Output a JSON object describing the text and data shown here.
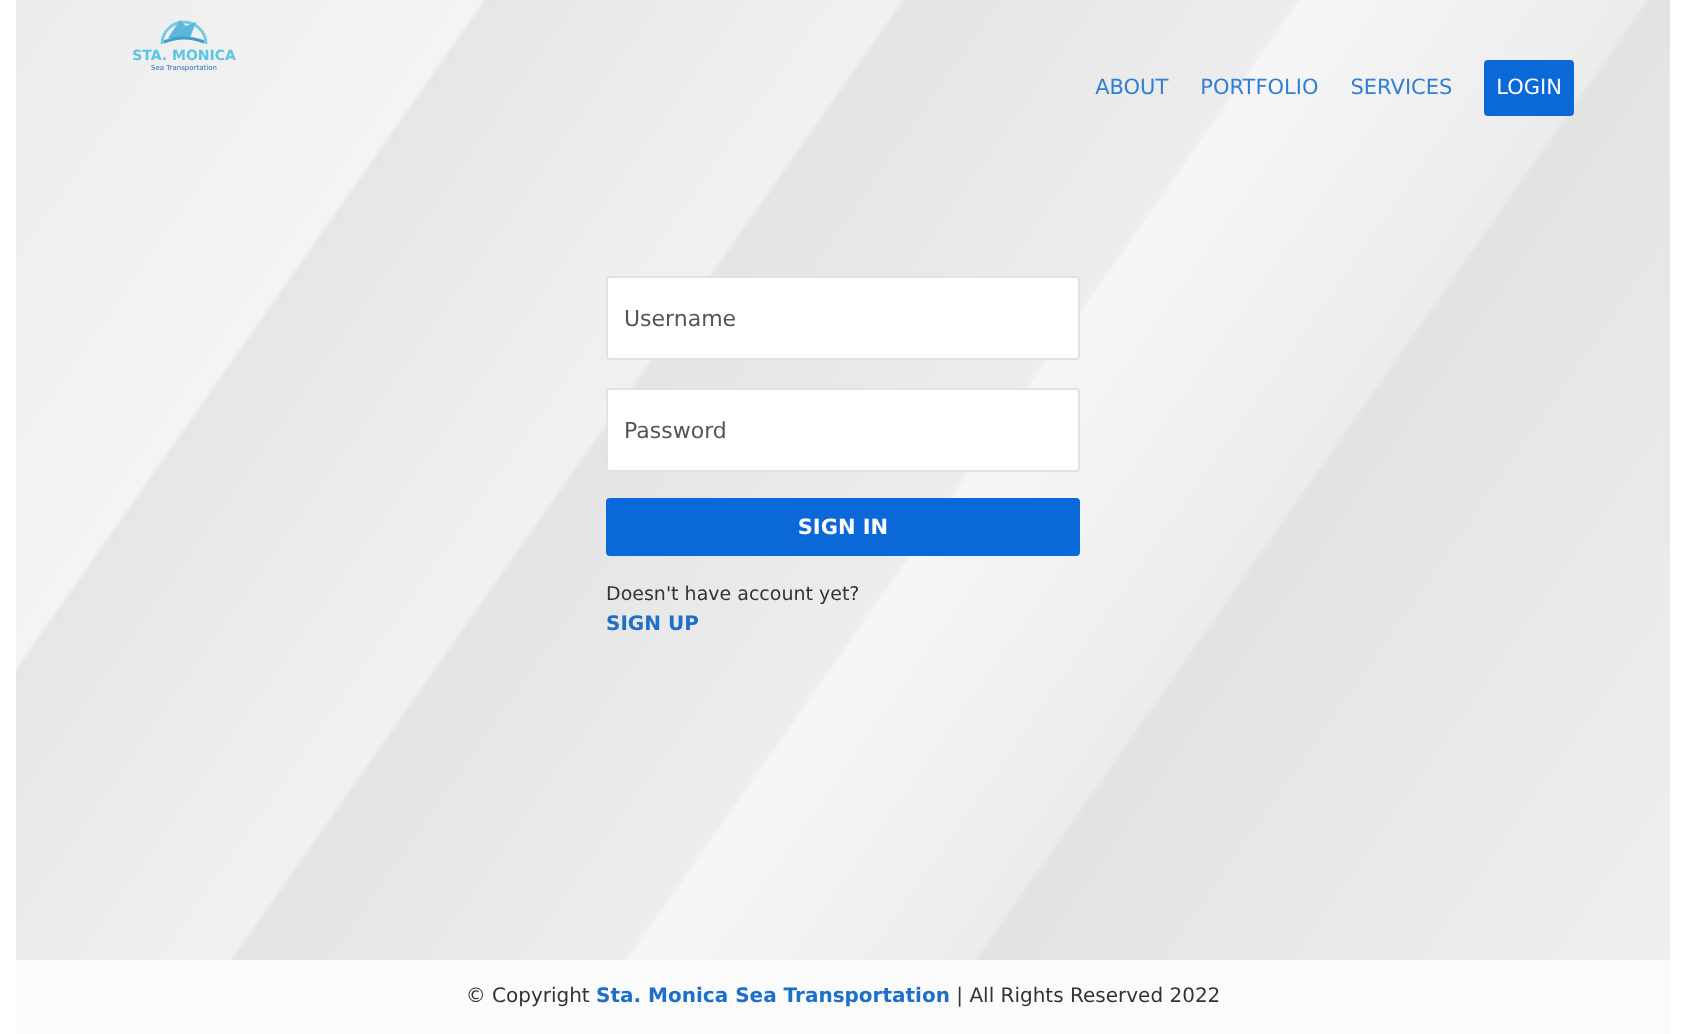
{
  "logo": {
    "name": "STA. MONICA",
    "tagline": "Sea Transportation"
  },
  "nav": [
    {
      "label": "ABOUT",
      "selected": false
    },
    {
      "label": "PORTFOLIO",
      "selected": false
    },
    {
      "label": "SERVICES",
      "selected": false
    },
    {
      "label": "LOGIN",
      "selected": true
    }
  ],
  "form": {
    "username": {
      "placeholder": "Username"
    },
    "password": {
      "placeholder": "Password"
    },
    "submit": "SIGN IN",
    "prompt": "Doesn't have account yet?",
    "signup": "SIGN UP"
  },
  "footer": {
    "prefix": "© Copyright ",
    "link": "Sta. Monica Sea Transportation",
    "suffix": " | All Rights Reserved 2022"
  }
}
